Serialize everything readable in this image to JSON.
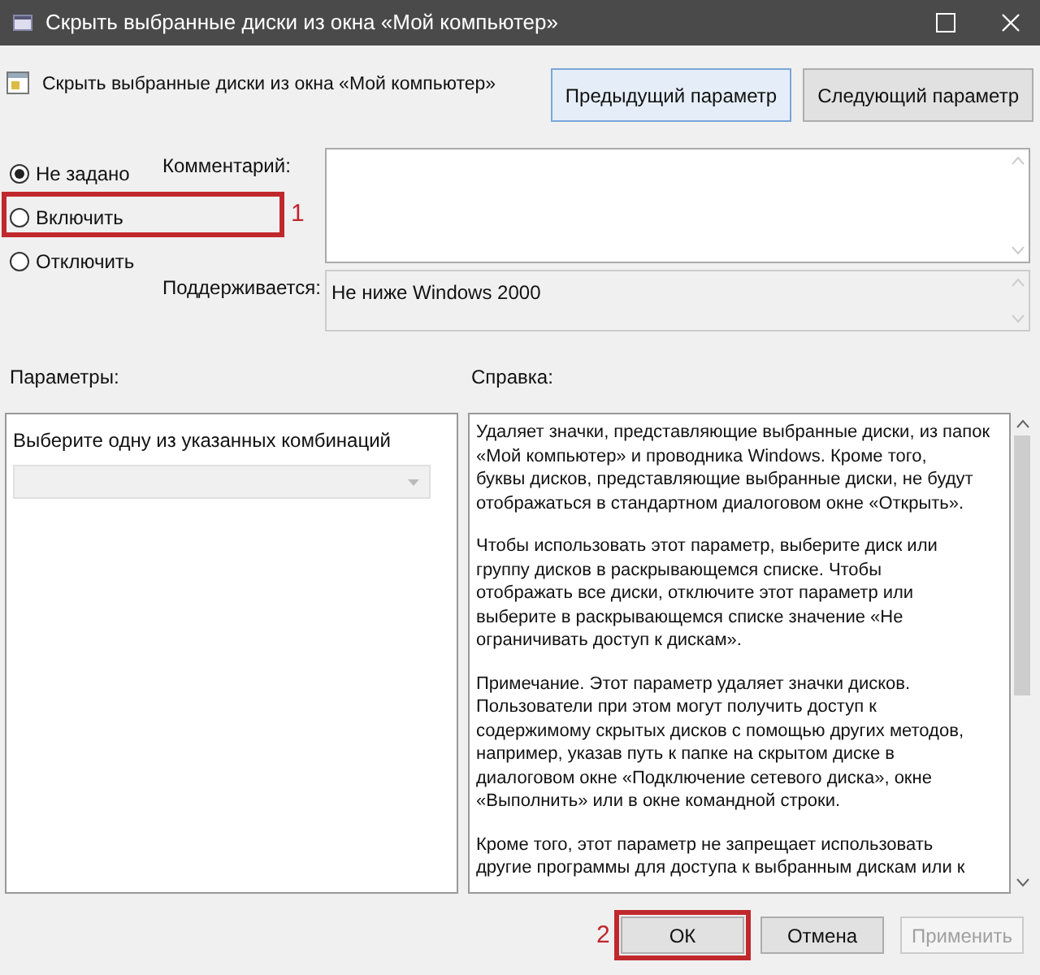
{
  "window": {
    "title": "Скрыть выбранные диски из окна «Мой компьютер»"
  },
  "header": {
    "title": "Скрыть выбранные диски из окна «Мой компьютер»",
    "buttons": [
      {
        "label": "Предыдущий параметр",
        "selected": true
      },
      {
        "label": "Следующий параметр",
        "selected": false
      }
    ]
  },
  "state_options": [
    {
      "label": "Не задано",
      "selected": true
    },
    {
      "label": "Включить",
      "selected": false,
      "annotation": "1"
    },
    {
      "label": "Отключить",
      "selected": false
    }
  ],
  "comment": {
    "label": "Комментарий:"
  },
  "supported": {
    "label": "Поддерживается:",
    "value": "Не ниже Windows 2000"
  },
  "parameters": {
    "label": "Параметры:",
    "prompt": "Выберите одну из указанных комбинаций",
    "dropdown_disabled": true
  },
  "help": {
    "label": "Справка:",
    "paragraphs": [
      [
        "Удаляет значки, представляющие выбранные диски, из папок",
        "«Мой компьютер» и проводника Windows.  Кроме того,",
        "буквы дисков, представляющие выбранные диски, не будут",
        "отображаться в стандартном диалоговом окне «Открыть»."
      ],
      [
        "Чтобы использовать этот параметр, выберите диск или",
        "группу дисков в раскрывающемся списке.  Чтобы",
        "отображать все диски, отключите этот параметр или",
        "выберите в раскрывающемся списке значение «Не",
        "ограничивать доступ к дискам»."
      ],
      [
        "Примечание. Этот параметр удаляет значки дисков.",
        "Пользователи при этом могут получить доступ к",
        "содержимому скрытых дисков с помощью других методов,",
        "например, указав путь к папке на скрытом диске в",
        "диалоговом окне «Подключение сетевого диска», окне",
        "«Выполнить» или в окне командной строки."
      ],
      [
        "Кроме того, этот параметр не запрещает использовать",
        "другие программы для доступа к выбранным дискам или к"
      ]
    ]
  },
  "footer_buttons": [
    {
      "label": "ОК",
      "disabled": false,
      "annotation": "2"
    },
    {
      "label": "Отмена",
      "disabled": false
    },
    {
      "label": "Применить",
      "disabled": true
    }
  ]
}
